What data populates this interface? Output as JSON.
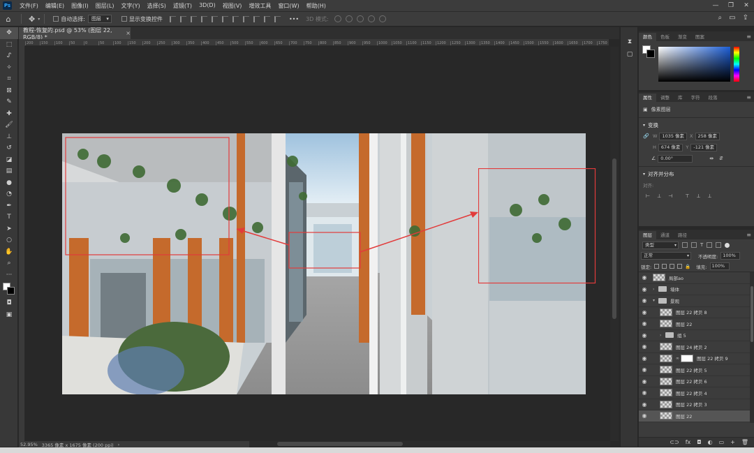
{
  "app": {
    "logo": "Ps"
  },
  "menu": [
    "文件(F)",
    "编辑(E)",
    "图像(I)",
    "图层(L)",
    "文字(Y)",
    "选择(S)",
    "滤镜(T)",
    "3D(D)",
    "视图(V)",
    "增效工具",
    "窗口(W)",
    "帮助(H)"
  ],
  "window_controls": {
    "minimize": "—",
    "restore": "❐",
    "close": "✕"
  },
  "options": {
    "auto_select_label": "自动选择:",
    "auto_select_value": "图层",
    "show_transform_label": "显示变换控件",
    "mode_3d": "3D 模式:",
    "more": "•••"
  },
  "document": {
    "tab_title": "教程-恢复的.psd @ 53% (图层 22, RGB/8) *",
    "close": "×"
  },
  "ruler_ticks": [
    "200",
    "150",
    "100",
    "50",
    "0",
    "50",
    "100",
    "150",
    "200",
    "250",
    "300",
    "350",
    "400",
    "450",
    "500",
    "550",
    "600",
    "650",
    "700",
    "750",
    "800",
    "850",
    "900",
    "950",
    "1000",
    "1050",
    "1100",
    "1150",
    "1200",
    "1250",
    "1300",
    "1350",
    "1400",
    "1450",
    "1500",
    "1550",
    "1600",
    "1650",
    "1700",
    "1750"
  ],
  "status": {
    "zoom": "52.95%",
    "doc_info": "3365 像素 x 1675 像素 (200 ppi)",
    "arrow": "›"
  },
  "color_panel": {
    "tabs": [
      "颜色",
      "色板",
      "渐变",
      "图案"
    ]
  },
  "properties_panel": {
    "tabs": [
      "属性",
      "调整",
      "库",
      "字符",
      "段落"
    ],
    "type_label": "像素图层",
    "transform_title": "变换",
    "w_label": "W",
    "w_value": "1035 像素",
    "x_label": "X",
    "x_value": "258 像素",
    "h_label": "H",
    "h_value": "674 像素",
    "y_label": "Y",
    "y_value": "-121 像素",
    "angle_value": "0.00°",
    "align_title": "对齐并分布",
    "align_label": "对齐:"
  },
  "layers_panel": {
    "tabs": [
      "图层",
      "通道",
      "路径"
    ],
    "filter_kind": "类型",
    "blend_mode": "正常",
    "opacity_label": "不透明度:",
    "opacity_value": "100%",
    "lock_label": "锁定:",
    "fill_label": "填充:",
    "fill_value": "100%",
    "layers": [
      {
        "name": "局部ao",
        "type": "smart",
        "indent": 0
      },
      {
        "name": "墙体",
        "type": "folder",
        "indent": 0
      },
      {
        "name": "景观",
        "type": "folder-open",
        "indent": 0
      },
      {
        "name": "图层 22 拷贝 8",
        "type": "pixel",
        "indent": 1
      },
      {
        "name": "图层 22",
        "type": "pixel",
        "indent": 1
      },
      {
        "name": "组 5",
        "type": "folder",
        "indent": 1
      },
      {
        "name": "图层 24 拷贝 2",
        "type": "pixel",
        "indent": 1
      },
      {
        "name": "图层 22 拷贝 9",
        "type": "masked",
        "indent": 1
      },
      {
        "name": "图层 22 拷贝 5",
        "type": "pixel",
        "indent": 1
      },
      {
        "name": "图层 22 拷贝 6",
        "type": "pixel",
        "indent": 1
      },
      {
        "name": "图层 22 拷贝 4",
        "type": "pixel",
        "indent": 1
      },
      {
        "name": "图层 22 拷贝 3",
        "type": "pixel",
        "indent": 1
      },
      {
        "name": "图层 22",
        "type": "pixel",
        "indent": 1,
        "selected": true
      }
    ],
    "bottom_icons": [
      "link-icon",
      "fx-icon",
      "mask-icon",
      "adjustment-icon",
      "group-icon",
      "new-layer-icon",
      "trash-icon"
    ]
  }
}
